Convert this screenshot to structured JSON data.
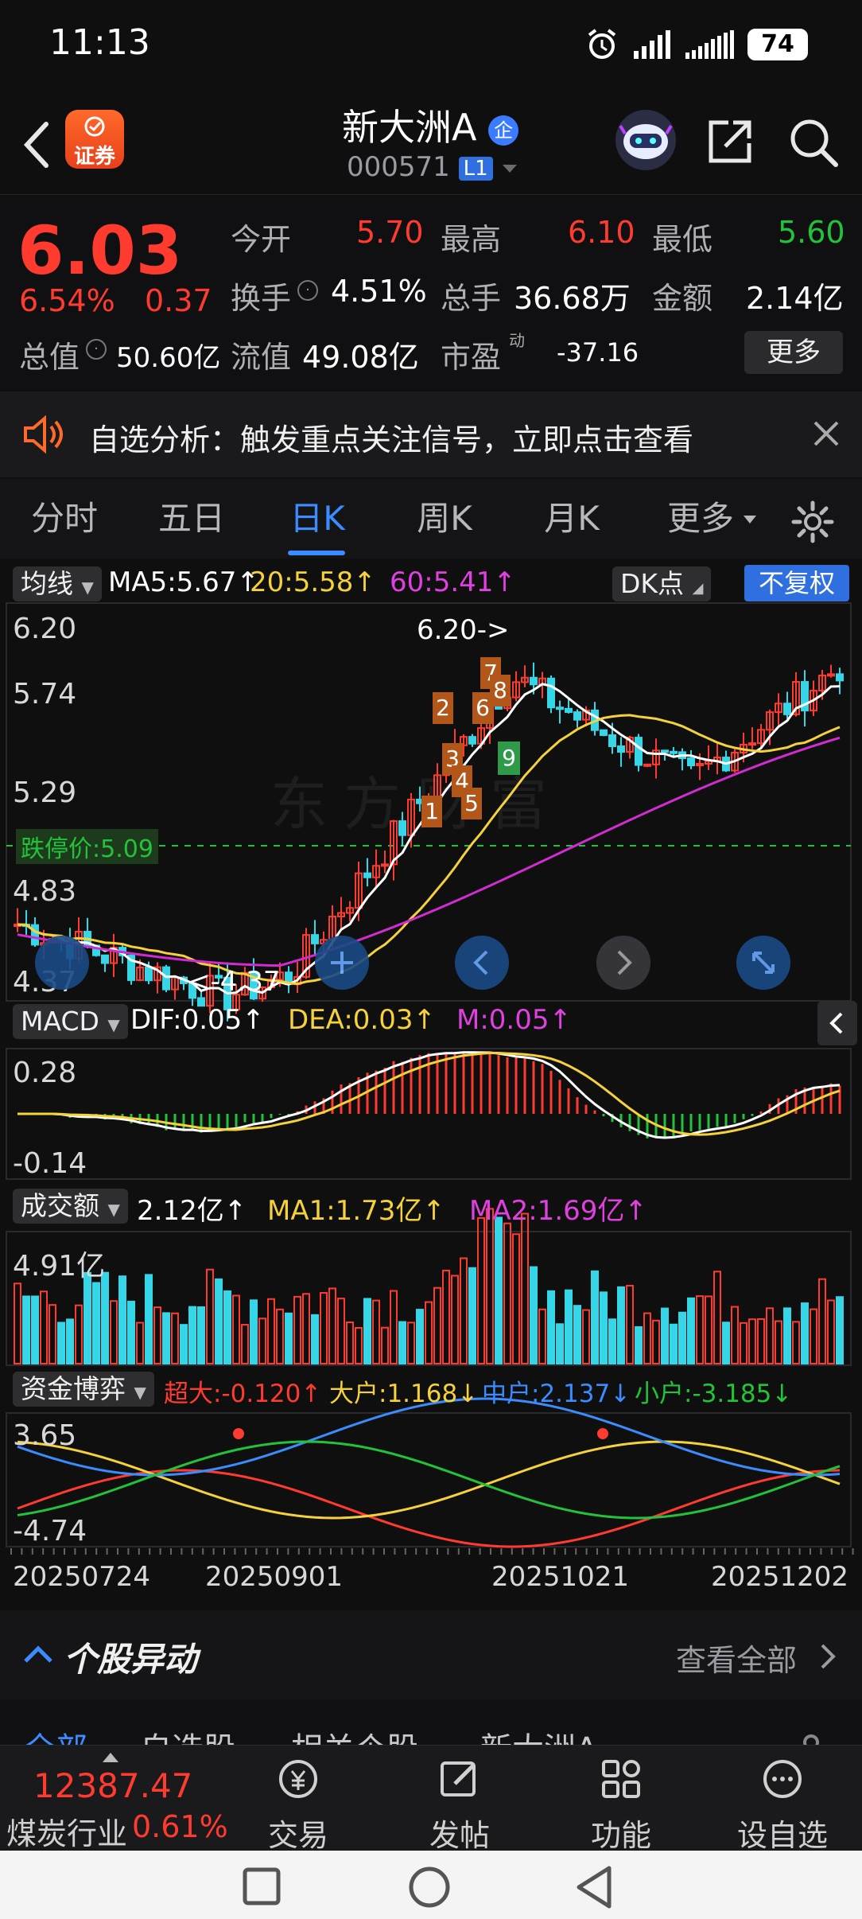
{
  "status": {
    "time": "11:13",
    "battery": "74"
  },
  "header": {
    "title": "新大洲A",
    "code": "000571",
    "level_badge": "L1",
    "broker_badge": "证券",
    "enterprise_badge": "企"
  },
  "quote": {
    "price": "6.03",
    "change_pct": "6.54%",
    "change_amt": "0.37",
    "open_label": "今开",
    "open": "5.70",
    "high_label": "最高",
    "high": "6.10",
    "low_label": "最低",
    "low": "5.60",
    "turnover_label": "换手",
    "turnover": "4.51%",
    "volume_label": "总手",
    "volume": "36.68万",
    "amount_label": "金额",
    "amount": "2.14亿",
    "mcap_label": "总值",
    "mcap": "50.60亿",
    "float_label": "流值",
    "float_mcap": "49.08亿",
    "pe_label": "市盈",
    "pe_sup": "动",
    "pe": "-37.16",
    "more": "更多"
  },
  "banner": {
    "text": "自选分析：触发重点关注信号，立即点击查看"
  },
  "tabs": [
    "分时",
    "五日",
    "日K",
    "周K",
    "月K",
    "更多"
  ],
  "active_tab": 2,
  "kline": {
    "indicator_dropdown": "均线",
    "ma5": "MA5:5.67↑",
    "ma20": "20:5.58↑",
    "ma60": "60:5.41↑",
    "dk_button": "DK点",
    "adjust_button": "不复权",
    "y_labels": [
      "6.20",
      "5.74",
      "5.29",
      "4.83",
      "4.37"
    ],
    "limit_down": "跌停价:5.09",
    "max_label": "6.20->",
    "min_label": "<-4.37",
    "watermark": "东方财富",
    "seq_numbers": [
      "1",
      "2",
      "3",
      "4",
      "5",
      "6",
      "7",
      "8",
      "9"
    ]
  },
  "macd": {
    "dropdown": "MACD",
    "dif": "DIF:0.05↑",
    "dea": "DEA:0.03↑",
    "m": "M:0.05↑",
    "y_top": "0.28",
    "y_bottom": "-0.14"
  },
  "vol": {
    "dropdown": "成交额",
    "value": "2.12亿↑",
    "ma1": "MA1:1.73亿↑",
    "ma2": "MA2:1.69亿↑",
    "y_top": "4.91亿"
  },
  "fund": {
    "dropdown": "资金博弈",
    "super": "超大:-0.120↑",
    "big": "大户:1.168↓",
    "mid": "中户:2.137↓",
    "small": "小户:-3.185↓",
    "y_top": "3.65",
    "y_bottom": "-4.74"
  },
  "dates": [
    "20250724",
    "20250901",
    "20251021",
    "20251202"
  ],
  "movement": {
    "title": "个股异动",
    "view_all": "查看全部",
    "tabs": [
      "全部",
      "自选股",
      "相关个股",
      "新大洲A"
    ]
  },
  "bottom": {
    "index_value": "12387.47",
    "index_name": "煤炭行业",
    "index_pct": "0.61%",
    "trade": "交易",
    "post": "发帖",
    "function": "功能",
    "add_watch": "设自选"
  },
  "colors": {
    "up": "#ff3b30",
    "down": "#22c33a",
    "accent": "#3b8cff",
    "ma5": "#ffffff",
    "ma20": "#f5d13a",
    "ma60": "#d02cd0",
    "vol_down": "#35d6e8"
  }
}
